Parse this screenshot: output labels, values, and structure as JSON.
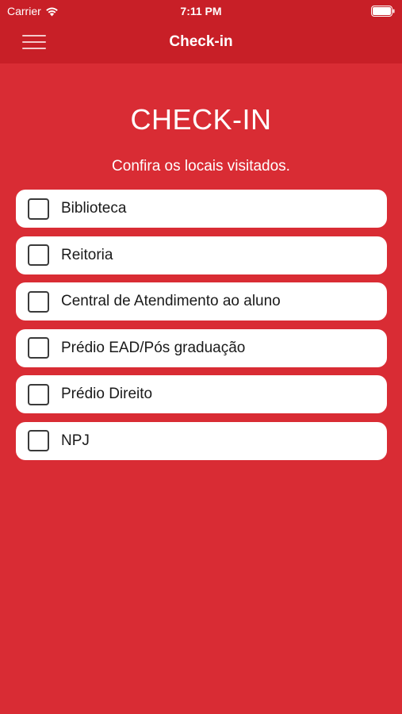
{
  "status_bar": {
    "carrier": "Carrier",
    "time": "7:11 PM",
    "wifi_icon": "wifi-icon",
    "battery_icon": "battery-icon"
  },
  "nav_bar": {
    "menu_icon": "hamburger-menu-icon",
    "title": "Check-in"
  },
  "main": {
    "heading": "CHECK-IN",
    "subheading": "Confira os locais visitados.",
    "locations": [
      {
        "label": "Biblioteca",
        "checked": false
      },
      {
        "label": "Reitoria",
        "checked": false
      },
      {
        "label": "Central de Atendimento ao aluno",
        "checked": false
      },
      {
        "label": "Prédio EAD/Pós graduação",
        "checked": false
      },
      {
        "label": "Prédio Direito",
        "checked": false
      },
      {
        "label": "NPJ",
        "checked": false
      }
    ]
  },
  "colors": {
    "background": "#d92c34",
    "nav_background": "#c81f27",
    "card": "#ffffff",
    "text_light": "#ffffff",
    "text_dark": "#1a1a1a"
  }
}
